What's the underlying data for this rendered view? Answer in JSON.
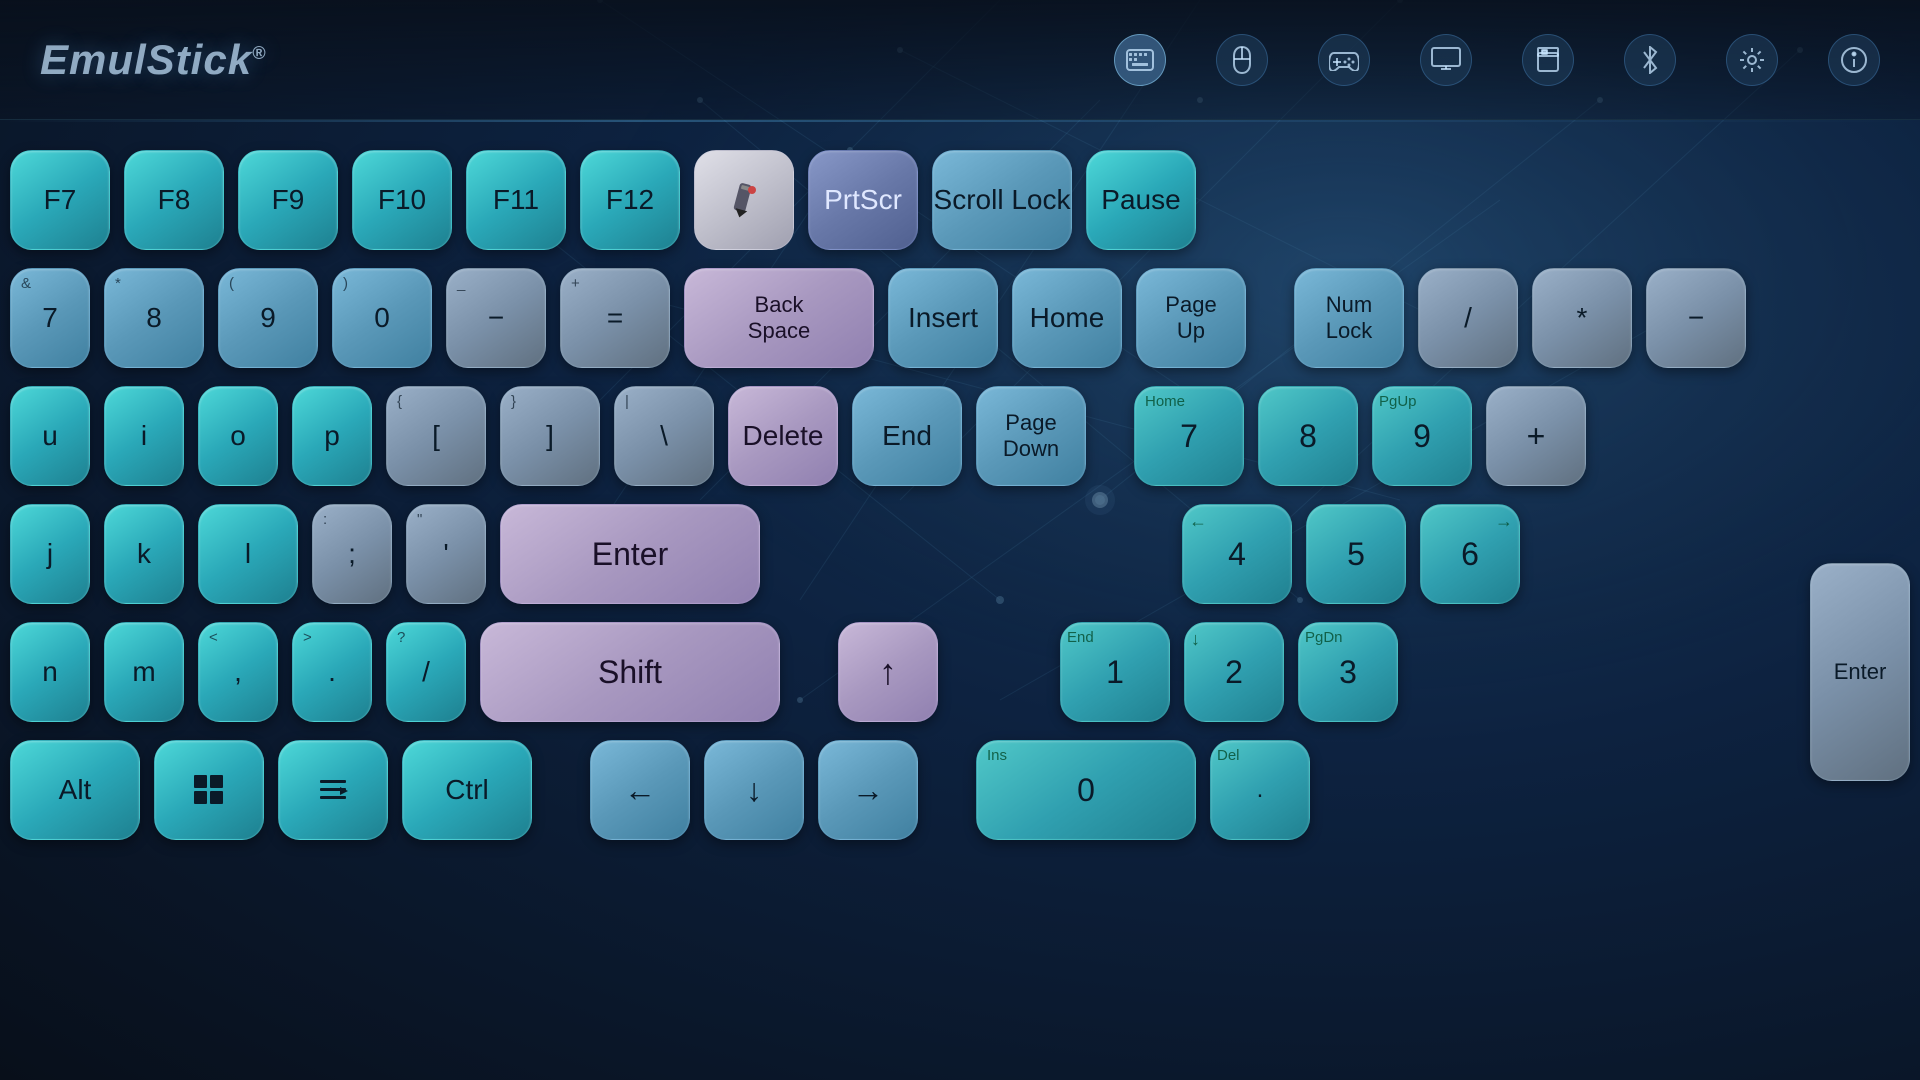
{
  "app": {
    "name": "EmulStick",
    "trademark": "®"
  },
  "header": {
    "icons": [
      {
        "name": "keyboard-icon",
        "label": "Keyboard",
        "symbol": "⌨",
        "active": true
      },
      {
        "name": "mouse-icon",
        "label": "Mouse",
        "symbol": "🖱",
        "active": false
      },
      {
        "name": "gamepad-icon",
        "label": "Gamepad",
        "symbol": "🎮",
        "active": false
      },
      {
        "name": "monitor-icon",
        "label": "Monitor",
        "symbol": "🖥",
        "active": false
      },
      {
        "name": "media-icon",
        "label": "Media",
        "symbol": "📟",
        "active": false
      },
      {
        "name": "bluetooth-icon",
        "label": "Bluetooth",
        "symbol": "⚡",
        "active": false
      },
      {
        "name": "settings-icon",
        "label": "Settings",
        "symbol": "⚙",
        "active": false
      },
      {
        "name": "info-icon",
        "label": "Info",
        "symbol": "ℹ",
        "active": false
      }
    ]
  },
  "keyboard": {
    "rows": {
      "row1": [
        "F7",
        "F8",
        "F9",
        "F10",
        "F11",
        "F12",
        "",
        "PrtScr",
        "Scroll Lock",
        "Pause"
      ],
      "row2": [
        "7",
        "8",
        "9",
        "0",
        "-",
        "=",
        "Back Space",
        "Insert",
        "Home",
        "Page Up",
        "Num Lock",
        "/",
        "*",
        "-"
      ],
      "row3": [
        "u",
        "i",
        "o",
        "p",
        "[",
        "]",
        "\\",
        "Delete",
        "End",
        "Page Down",
        "Home 7",
        "8",
        "PgUp 9",
        "+"
      ],
      "row4": [
        "j",
        "k",
        "l",
        ";",
        "'",
        "Enter",
        "←4",
        "5",
        "→6"
      ],
      "row5": [
        "n",
        "m",
        ",",
        ".",
        "/ ",
        "Shift",
        "↑",
        "End 1",
        "↓2",
        "PgDn 3",
        "Enter"
      ],
      "row6": [
        "Alt",
        "Win",
        "Menu",
        "Ctrl",
        "←",
        "↓",
        "→",
        "Ins 0",
        "Del",
        "."
      ]
    }
  }
}
